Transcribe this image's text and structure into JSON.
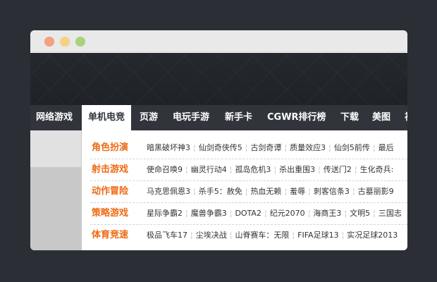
{
  "nav": {
    "items": [
      "网络游戏",
      "单机电竞",
      "页游",
      "电玩手游",
      "新手卡",
      "CGWR排行榜",
      "下载",
      "美图",
      "视"
    ]
  },
  "rows": [
    {
      "category": "角色扮演",
      "links": [
        "暗黑破坏神3",
        "仙剑奇侠传5",
        "古剑奇谭",
        "质量效应3",
        "仙剑5前传",
        "最后"
      ]
    },
    {
      "category": "射击游戏",
      "links": [
        "使命召唤9",
        "幽灵行动4",
        "孤岛危机3",
        "杀出重围3",
        "传送门2",
        "生化奇兵:"
      ]
    },
    {
      "category": "动作冒险",
      "links": [
        "马克思佩恩3",
        "杀手5：赦免",
        "热血无赖",
        "羞辱",
        "刺客信条3",
        "古墓丽影9"
      ]
    },
    {
      "category": "策略游戏",
      "links": [
        "星际争霸2",
        "魔兽争霸3",
        "DOTA2",
        "纪元2070",
        "海商王3",
        "文明5",
        "三国志"
      ]
    },
    {
      "category": "体育竞速",
      "links": [
        "极品飞车17",
        "尘埃决战",
        "山脊赛车：无限",
        "FIFA足球13",
        "实况足球2013"
      ]
    }
  ]
}
